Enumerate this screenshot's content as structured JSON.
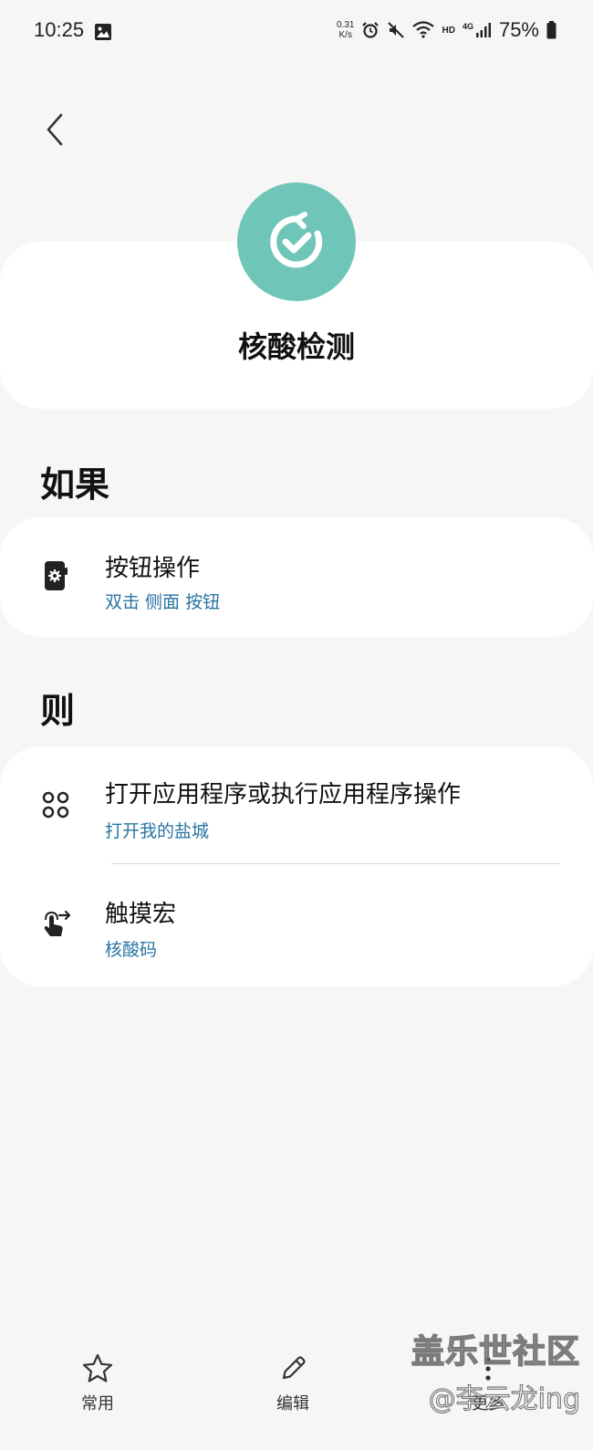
{
  "status_bar": {
    "time": "10:25",
    "speed_value": "0.31",
    "speed_unit": "K/s",
    "hd": "HD",
    "network": "4G",
    "battery": "75%"
  },
  "routine": {
    "title": "核酸检测",
    "icon": "routine-check-icon",
    "icon_color": "#6fc5b7"
  },
  "if_section": {
    "title": "如果",
    "items": [
      {
        "title": "按钮操作",
        "subtitle": "双击 侧面 按钮",
        "icon": "side-button-icon"
      }
    ]
  },
  "then_section": {
    "title": "则",
    "items": [
      {
        "title": "打开应用程序或执行应用程序操作",
        "subtitle": "打开我的盐城",
        "icon": "apps-grid-icon"
      },
      {
        "title": "触摸宏",
        "subtitle": "核酸码",
        "icon": "touch-macro-icon"
      }
    ]
  },
  "bottom_nav": {
    "items": [
      {
        "label": "常用",
        "icon": "star-icon"
      },
      {
        "label": "编辑",
        "icon": "pencil-icon"
      },
      {
        "label": "更多",
        "icon": "more-vertical-icon"
      }
    ]
  },
  "watermark": {
    "line1": "盖乐世社区",
    "line2": "@李云龙ing"
  },
  "colors": {
    "background": "#f6f6f6",
    "card": "#ffffff",
    "subtitle_blue": "#2874a2"
  }
}
